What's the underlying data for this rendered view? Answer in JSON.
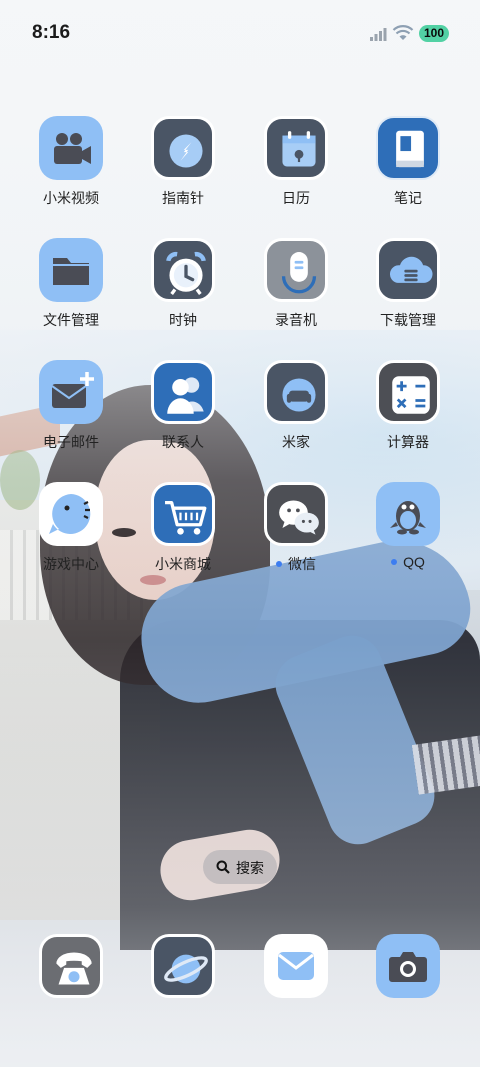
{
  "status_bar": {
    "time": "8:16",
    "battery": "100"
  },
  "apps": [
    {
      "label": "小米视频",
      "icon": "video-camera-icon"
    },
    {
      "label": "指南针",
      "icon": "compass-icon"
    },
    {
      "label": "日历",
      "icon": "calendar-icon"
    },
    {
      "label": "笔记",
      "icon": "notebook-icon"
    },
    {
      "label": "文件管理",
      "icon": "folder-icon"
    },
    {
      "label": "时钟",
      "icon": "alarm-clock-icon"
    },
    {
      "label": "录音机",
      "icon": "microphone-icon"
    },
    {
      "label": "下载管理",
      "icon": "cloud-download-icon"
    },
    {
      "label": "电子邮件",
      "icon": "envelope-plus-icon"
    },
    {
      "label": "联系人",
      "icon": "contacts-icon"
    },
    {
      "label": "米家",
      "icon": "sofa-icon"
    },
    {
      "label": "计算器",
      "icon": "calculator-icon"
    },
    {
      "label": "游戏中心",
      "icon": "chat-bubble-face-icon"
    },
    {
      "label": "小米商城",
      "icon": "shopping-cart-icon"
    },
    {
      "label": "微信",
      "icon": "wechat-icon",
      "new_dot": true
    },
    {
      "label": "QQ",
      "icon": "penguin-icon",
      "new_dot": true
    }
  ],
  "search": {
    "label": "搜索"
  },
  "dock": [
    {
      "icon": "telephone-icon"
    },
    {
      "icon": "planet-browser-icon"
    },
    {
      "icon": "mail-icon"
    },
    {
      "icon": "camera-icon"
    }
  ],
  "colors": {
    "icon_dark": "#4a5565",
    "icon_blue": "#8fbff5",
    "accent_blue": "#2e6eb8",
    "dot": "#3d7df0"
  }
}
